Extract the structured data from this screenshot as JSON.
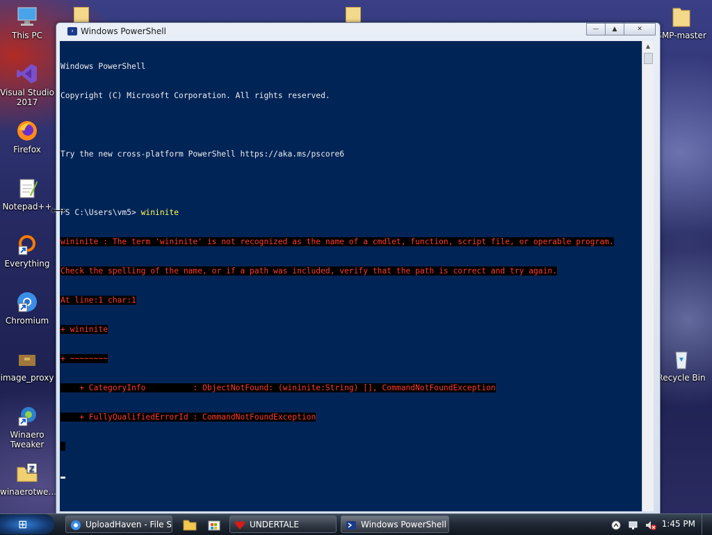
{
  "desktop": {
    "icons": [
      {
        "label": "This PC",
        "icon": "computer-icon"
      },
      {
        "label": "Visual Studio 2017",
        "icon": "visual-studio-icon"
      },
      {
        "label": "Firefox",
        "icon": "firefox-icon"
      },
      {
        "label": "Notepad++",
        "icon": "notepadpp-icon"
      },
      {
        "label": "Everything",
        "icon": "everything-icon"
      },
      {
        "label": "Chromium",
        "icon": "chromium-icon"
      },
      {
        "label": "image_proxy",
        "icon": "image-proxy-icon"
      },
      {
        "label": "Winaero Tweaker",
        "icon": "winaero-icon"
      },
      {
        "label": "winaerotwe...",
        "icon": "zip-folder-icon"
      },
      {
        "label": "SMP-master",
        "icon": "folder-icon"
      },
      {
        "label": "Recycle Bin",
        "icon": "recycle-bin-icon"
      }
    ]
  },
  "window": {
    "title": "Windows PowerShell",
    "controls": {
      "minimize": "—",
      "maximize": "▲",
      "close": "✕"
    },
    "console": {
      "banner1": "Windows PowerShell",
      "banner2": "Copyright (C) Microsoft Corporation. All rights reserved.",
      "tip": "Try the new cross-platform PowerShell https://aka.ms/pscore6",
      "prompt": "PS C:\\Users\\vm5> ",
      "command": "wininite",
      "error_lines": [
        "wininite : The term 'wininite' is not recognized as the name of a cmdlet, function, script file, or operable program.",
        "Check the spelling of the name, or if a path was included, verify that the path is correct and try again.",
        "At line:1 char:1",
        "+ wininite",
        "+ ~~~~~~~~",
        "    + CategoryInfo          : ObjectNotFound: (wininite:String) [], CommandNotFoundException",
        "    + FullyQualifiedErrorId : CommandNotFoundException"
      ]
    }
  },
  "taskbar": {
    "start_label": "⊞",
    "buttons": [
      {
        "label": "UploadHaven - File S...",
        "icon": "chromium-icon"
      },
      {
        "label": "UNDERTALE",
        "icon": "heart-icon"
      },
      {
        "label": "Windows PowerShell",
        "icon": "powershell-icon"
      }
    ],
    "clock": "1:45 PM"
  },
  "colors": {
    "console_bg": "#012456",
    "console_fg": "#eeedf0",
    "error_fg": "#ff3b30",
    "command_fg": "#ffff55"
  }
}
